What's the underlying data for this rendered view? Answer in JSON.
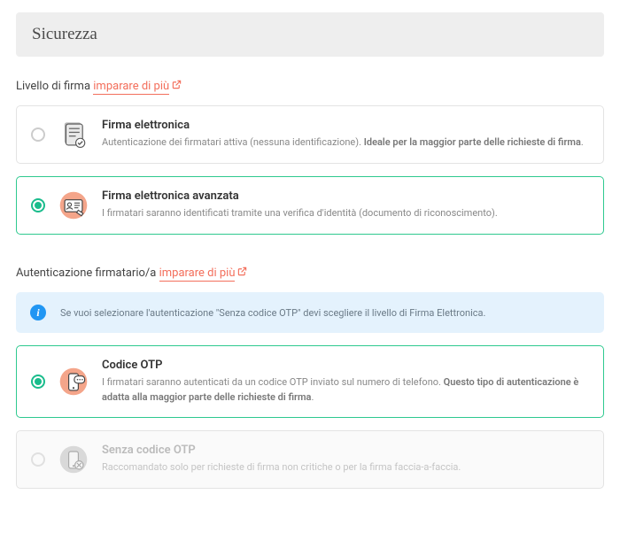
{
  "header": {
    "title": "Sicurezza"
  },
  "section1": {
    "label": "Livello di firma",
    "learn_more": "imparare di più",
    "options": [
      {
        "title": "Firma elettronica",
        "desc_plain": "Autenticazione dei firmatari attiva (nessuna identificazione). ",
        "desc_bold": "Ideale per la maggior parte delle richieste di firma",
        "desc_tail": "."
      },
      {
        "title": "Firma elettronica avanzata",
        "desc_plain": "I firmatari saranno identificati tramite una verifica d'identità (documento di riconoscimento).",
        "desc_bold": "",
        "desc_tail": ""
      }
    ]
  },
  "section2": {
    "label": "Autenticazione firmatario/a",
    "learn_more": "imparare di più",
    "info": "Se vuoi selezionare l'autenticazione \"Senza codice OTP\" devi scegliere il livello di Firma Elettronica.",
    "options": [
      {
        "title": "Codice OTP",
        "desc_plain": "I firmatari saranno autenticati da un codice OTP inviato sul numero di telefono. ",
        "desc_bold": "Questo tipo di autenticazione è adatta alla maggior parte delle richieste di firma",
        "desc_tail": "."
      },
      {
        "title": "Senza codice OTP",
        "desc_plain": "Raccomandato solo per richieste di firma non critiche o per la firma faccia-a-faccia.",
        "desc_bold": "",
        "desc_tail": ""
      }
    ]
  }
}
